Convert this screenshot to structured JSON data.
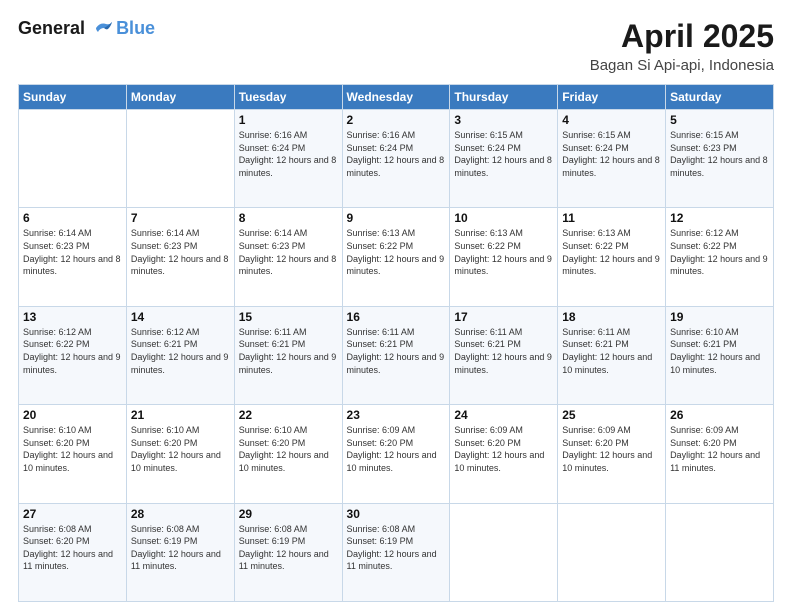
{
  "header": {
    "logo_line1": "General",
    "logo_line2": "Blue",
    "month": "April 2025",
    "location": "Bagan Si Api-api, Indonesia"
  },
  "weekdays": [
    "Sunday",
    "Monday",
    "Tuesday",
    "Wednesday",
    "Thursday",
    "Friday",
    "Saturday"
  ],
  "weeks": [
    [
      {
        "day": "",
        "sunrise": "",
        "sunset": "",
        "daylight": ""
      },
      {
        "day": "",
        "sunrise": "",
        "sunset": "",
        "daylight": ""
      },
      {
        "day": "1",
        "sunrise": "Sunrise: 6:16 AM",
        "sunset": "Sunset: 6:24 PM",
        "daylight": "Daylight: 12 hours and 8 minutes."
      },
      {
        "day": "2",
        "sunrise": "Sunrise: 6:16 AM",
        "sunset": "Sunset: 6:24 PM",
        "daylight": "Daylight: 12 hours and 8 minutes."
      },
      {
        "day": "3",
        "sunrise": "Sunrise: 6:15 AM",
        "sunset": "Sunset: 6:24 PM",
        "daylight": "Daylight: 12 hours and 8 minutes."
      },
      {
        "day": "4",
        "sunrise": "Sunrise: 6:15 AM",
        "sunset": "Sunset: 6:24 PM",
        "daylight": "Daylight: 12 hours and 8 minutes."
      },
      {
        "day": "5",
        "sunrise": "Sunrise: 6:15 AM",
        "sunset": "Sunset: 6:23 PM",
        "daylight": "Daylight: 12 hours and 8 minutes."
      }
    ],
    [
      {
        "day": "6",
        "sunrise": "Sunrise: 6:14 AM",
        "sunset": "Sunset: 6:23 PM",
        "daylight": "Daylight: 12 hours and 8 minutes."
      },
      {
        "day": "7",
        "sunrise": "Sunrise: 6:14 AM",
        "sunset": "Sunset: 6:23 PM",
        "daylight": "Daylight: 12 hours and 8 minutes."
      },
      {
        "day": "8",
        "sunrise": "Sunrise: 6:14 AM",
        "sunset": "Sunset: 6:23 PM",
        "daylight": "Daylight: 12 hours and 8 minutes."
      },
      {
        "day": "9",
        "sunrise": "Sunrise: 6:13 AM",
        "sunset": "Sunset: 6:22 PM",
        "daylight": "Daylight: 12 hours and 9 minutes."
      },
      {
        "day": "10",
        "sunrise": "Sunrise: 6:13 AM",
        "sunset": "Sunset: 6:22 PM",
        "daylight": "Daylight: 12 hours and 9 minutes."
      },
      {
        "day": "11",
        "sunrise": "Sunrise: 6:13 AM",
        "sunset": "Sunset: 6:22 PM",
        "daylight": "Daylight: 12 hours and 9 minutes."
      },
      {
        "day": "12",
        "sunrise": "Sunrise: 6:12 AM",
        "sunset": "Sunset: 6:22 PM",
        "daylight": "Daylight: 12 hours and 9 minutes."
      }
    ],
    [
      {
        "day": "13",
        "sunrise": "Sunrise: 6:12 AM",
        "sunset": "Sunset: 6:22 PM",
        "daylight": "Daylight: 12 hours and 9 minutes."
      },
      {
        "day": "14",
        "sunrise": "Sunrise: 6:12 AM",
        "sunset": "Sunset: 6:21 PM",
        "daylight": "Daylight: 12 hours and 9 minutes."
      },
      {
        "day": "15",
        "sunrise": "Sunrise: 6:11 AM",
        "sunset": "Sunset: 6:21 PM",
        "daylight": "Daylight: 12 hours and 9 minutes."
      },
      {
        "day": "16",
        "sunrise": "Sunrise: 6:11 AM",
        "sunset": "Sunset: 6:21 PM",
        "daylight": "Daylight: 12 hours and 9 minutes."
      },
      {
        "day": "17",
        "sunrise": "Sunrise: 6:11 AM",
        "sunset": "Sunset: 6:21 PM",
        "daylight": "Daylight: 12 hours and 9 minutes."
      },
      {
        "day": "18",
        "sunrise": "Sunrise: 6:11 AM",
        "sunset": "Sunset: 6:21 PM",
        "daylight": "Daylight: 12 hours and 10 minutes."
      },
      {
        "day": "19",
        "sunrise": "Sunrise: 6:10 AM",
        "sunset": "Sunset: 6:21 PM",
        "daylight": "Daylight: 12 hours and 10 minutes."
      }
    ],
    [
      {
        "day": "20",
        "sunrise": "Sunrise: 6:10 AM",
        "sunset": "Sunset: 6:20 PM",
        "daylight": "Daylight: 12 hours and 10 minutes."
      },
      {
        "day": "21",
        "sunrise": "Sunrise: 6:10 AM",
        "sunset": "Sunset: 6:20 PM",
        "daylight": "Daylight: 12 hours and 10 minutes."
      },
      {
        "day": "22",
        "sunrise": "Sunrise: 6:10 AM",
        "sunset": "Sunset: 6:20 PM",
        "daylight": "Daylight: 12 hours and 10 minutes."
      },
      {
        "day": "23",
        "sunrise": "Sunrise: 6:09 AM",
        "sunset": "Sunset: 6:20 PM",
        "daylight": "Daylight: 12 hours and 10 minutes."
      },
      {
        "day": "24",
        "sunrise": "Sunrise: 6:09 AM",
        "sunset": "Sunset: 6:20 PM",
        "daylight": "Daylight: 12 hours and 10 minutes."
      },
      {
        "day": "25",
        "sunrise": "Sunrise: 6:09 AM",
        "sunset": "Sunset: 6:20 PM",
        "daylight": "Daylight: 12 hours and 10 minutes."
      },
      {
        "day": "26",
        "sunrise": "Sunrise: 6:09 AM",
        "sunset": "Sunset: 6:20 PM",
        "daylight": "Daylight: 12 hours and 11 minutes."
      }
    ],
    [
      {
        "day": "27",
        "sunrise": "Sunrise: 6:08 AM",
        "sunset": "Sunset: 6:20 PM",
        "daylight": "Daylight: 12 hours and 11 minutes."
      },
      {
        "day": "28",
        "sunrise": "Sunrise: 6:08 AM",
        "sunset": "Sunset: 6:19 PM",
        "daylight": "Daylight: 12 hours and 11 minutes."
      },
      {
        "day": "29",
        "sunrise": "Sunrise: 6:08 AM",
        "sunset": "Sunset: 6:19 PM",
        "daylight": "Daylight: 12 hours and 11 minutes."
      },
      {
        "day": "30",
        "sunrise": "Sunrise: 6:08 AM",
        "sunset": "Sunset: 6:19 PM",
        "daylight": "Daylight: 12 hours and 11 minutes."
      },
      {
        "day": "",
        "sunrise": "",
        "sunset": "",
        "daylight": ""
      },
      {
        "day": "",
        "sunrise": "",
        "sunset": "",
        "daylight": ""
      },
      {
        "day": "",
        "sunrise": "",
        "sunset": "",
        "daylight": ""
      }
    ]
  ]
}
